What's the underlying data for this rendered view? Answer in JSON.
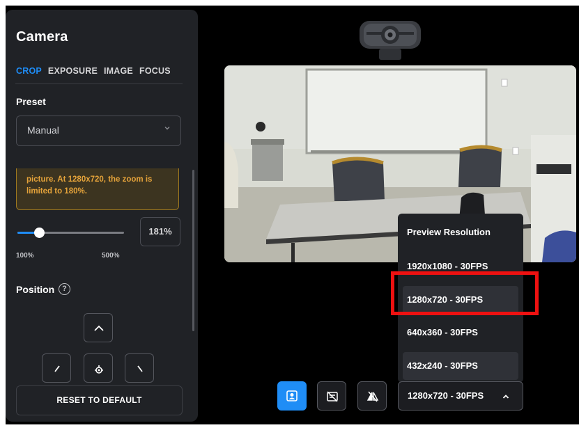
{
  "panel": {
    "title": "Camera",
    "tabs": [
      {
        "label": "CROP",
        "active": true
      },
      {
        "label": "EXPOSURE",
        "active": false
      },
      {
        "label": "IMAGE",
        "active": false
      },
      {
        "label": "FOCUS",
        "active": false
      }
    ],
    "preset_label": "Preset",
    "preset_value": "Manual",
    "warning_text": "picture. At 1280x720, the zoom is limited to 180%.",
    "zoom": {
      "value_text": "181%",
      "min_label": "100%",
      "max_label": "500%",
      "min": 100,
      "max": 500,
      "value": 181
    },
    "position_label": "Position",
    "help_glyph": "?",
    "reset_label": "RESET TO DEFAULT"
  },
  "resolution_menu": {
    "title": "Preview Resolution",
    "options": [
      "1920x1080 - 30FPS",
      "1280x720 - 30FPS",
      "640x360 - 30FPS",
      "432x240 - 30FPS"
    ],
    "selected": "1280x720 - 30FPS"
  },
  "toolbar": {
    "current_resolution": "1280x720 - 30FPS",
    "buttons": [
      {
        "icon": "portrait-icon",
        "active": true
      },
      {
        "icon": "hide-overlay-icon",
        "active": false
      },
      {
        "icon": "mirror-flip-icon",
        "active": false
      }
    ]
  },
  "colors": {
    "accent": "#1f8df6",
    "warning": "#e5a33a",
    "highlight": "#ee1111",
    "panel": "#202226"
  }
}
